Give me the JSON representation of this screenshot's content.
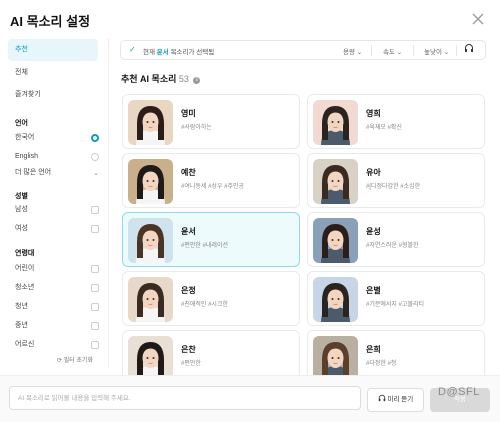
{
  "title": "AI 목소리 설정",
  "sidebar": {
    "nav": [
      {
        "label": "추천",
        "active": true
      },
      {
        "label": "전체",
        "active": false
      },
      {
        "label": "즐겨찾기",
        "active": false
      }
    ],
    "language": {
      "heading": "언어",
      "options": [
        {
          "label": "한국어",
          "selected": true
        },
        {
          "label": "English",
          "selected": false
        }
      ],
      "more": "더 많은 언어"
    },
    "gender": {
      "heading": "성별",
      "options": [
        "남성",
        "여성"
      ]
    },
    "age": {
      "heading": "연령대",
      "options": [
        "어린이",
        "청소년",
        "청년",
        "중년",
        "어르신"
      ]
    },
    "reset": "필터 초기화"
  },
  "topbar": {
    "prefix": "현재",
    "selected_name": "윤서",
    "suffix": "목소리가 선택됨",
    "filters": [
      "용량",
      "속도",
      "높낮이"
    ]
  },
  "section": {
    "title": "추천 AI 목소리",
    "count": "53"
  },
  "cards": [
    {
      "name": "영미",
      "tags": "#사람아하는",
      "selected": false
    },
    {
      "name": "영희",
      "tags": "#육재모 #확신",
      "selected": false
    },
    {
      "name": "예찬",
      "tags": "#여니동세 #성우 #주인공",
      "selected": false
    },
    {
      "name": "유아",
      "tags": "#[다정다감한 #소심한",
      "selected": false
    },
    {
      "name": "윤서",
      "tags": "#편안한 #내레이션",
      "selected": true
    },
    {
      "name": "윤성",
      "tags": "#자연스러운 #형볼한",
      "selected": false
    },
    {
      "name": "은정",
      "tags": "#친애적인 #시크한",
      "selected": false
    },
    {
      "name": "은별",
      "tags": "#기분에서지 #고볼리티",
      "selected": false
    },
    {
      "name": "은찬",
      "tags": "#편안한",
      "selected": false
    },
    {
      "name": "은희",
      "tags": "#다정한 #청",
      "selected": false
    }
  ],
  "bottom": {
    "placeholder": "AI 목소리로 읽어볼 내용을 입력해 주세요.",
    "preview": "미리 듣기",
    "apply": "적용",
    "watermark": "D@SFL"
  },
  "colors": {
    "accent": "#1a98b8",
    "selected_card_bg": "#eefbfc",
    "selected_card_border": "#8ddbe8"
  }
}
